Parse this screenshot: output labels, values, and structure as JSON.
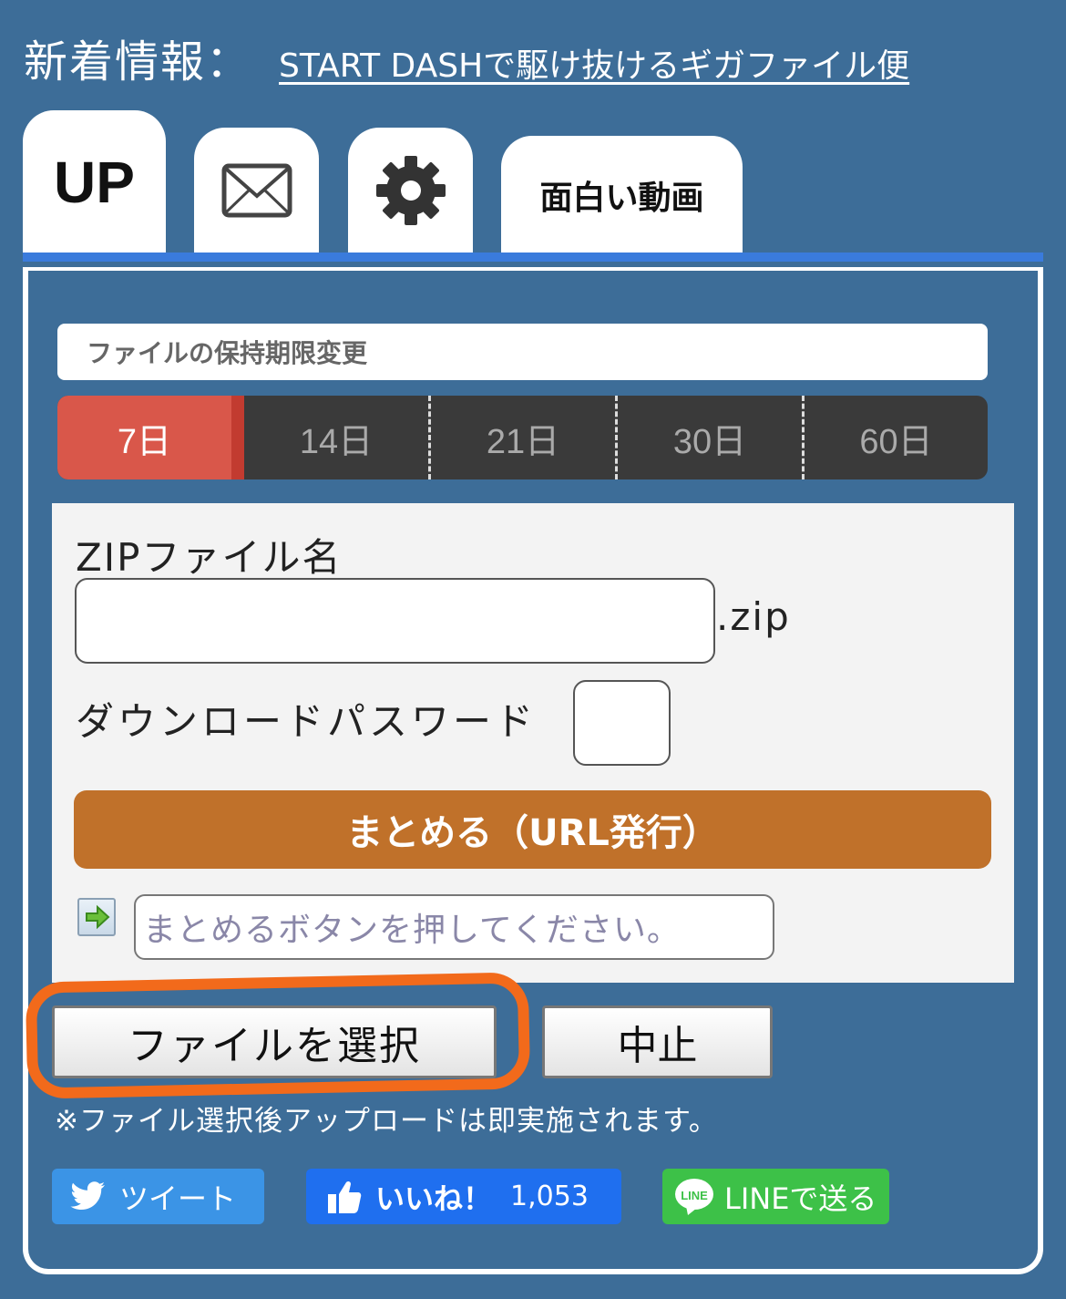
{
  "header": {
    "news_label": "新着情報：",
    "news_link": "START DASHで駆け抜けるギガファイル便"
  },
  "tabs": {
    "up": "UP",
    "mail_icon": "envelope-icon",
    "settings_icon": "gear-icon",
    "video": "面白い動画"
  },
  "retention": {
    "title": "ファイルの保持期限変更",
    "options": [
      "7日",
      "14日",
      "21日",
      "30日",
      "60日"
    ],
    "selected": "7日"
  },
  "zip": {
    "label": "ZIPファイル名",
    "value": "",
    "extension": ".zip"
  },
  "password": {
    "label": "ダウンロードパスワード",
    "value": ""
  },
  "combine_button": "まとめる（URL発行）",
  "url_output_placeholder": "まとめるボタンを押してください。",
  "file_select_button": "ファイルを選択",
  "cancel_button": "中止",
  "note": "※ファイル選択後アップロードは即実施されます。",
  "share": {
    "tweet": "ツイート",
    "like": "いいね！",
    "like_count": "1,053",
    "line_badge": "LINE",
    "line": "LINEで送る"
  },
  "colors": {
    "background": "#3d6d98",
    "tab_accent": "#3a7bdc",
    "selected_period": "#d9574a",
    "combine_button": "#c0712a",
    "highlight": "#f26a1b",
    "twitter": "#3b94e6",
    "facebook": "#1f6fef",
    "line": "#3dc148"
  }
}
